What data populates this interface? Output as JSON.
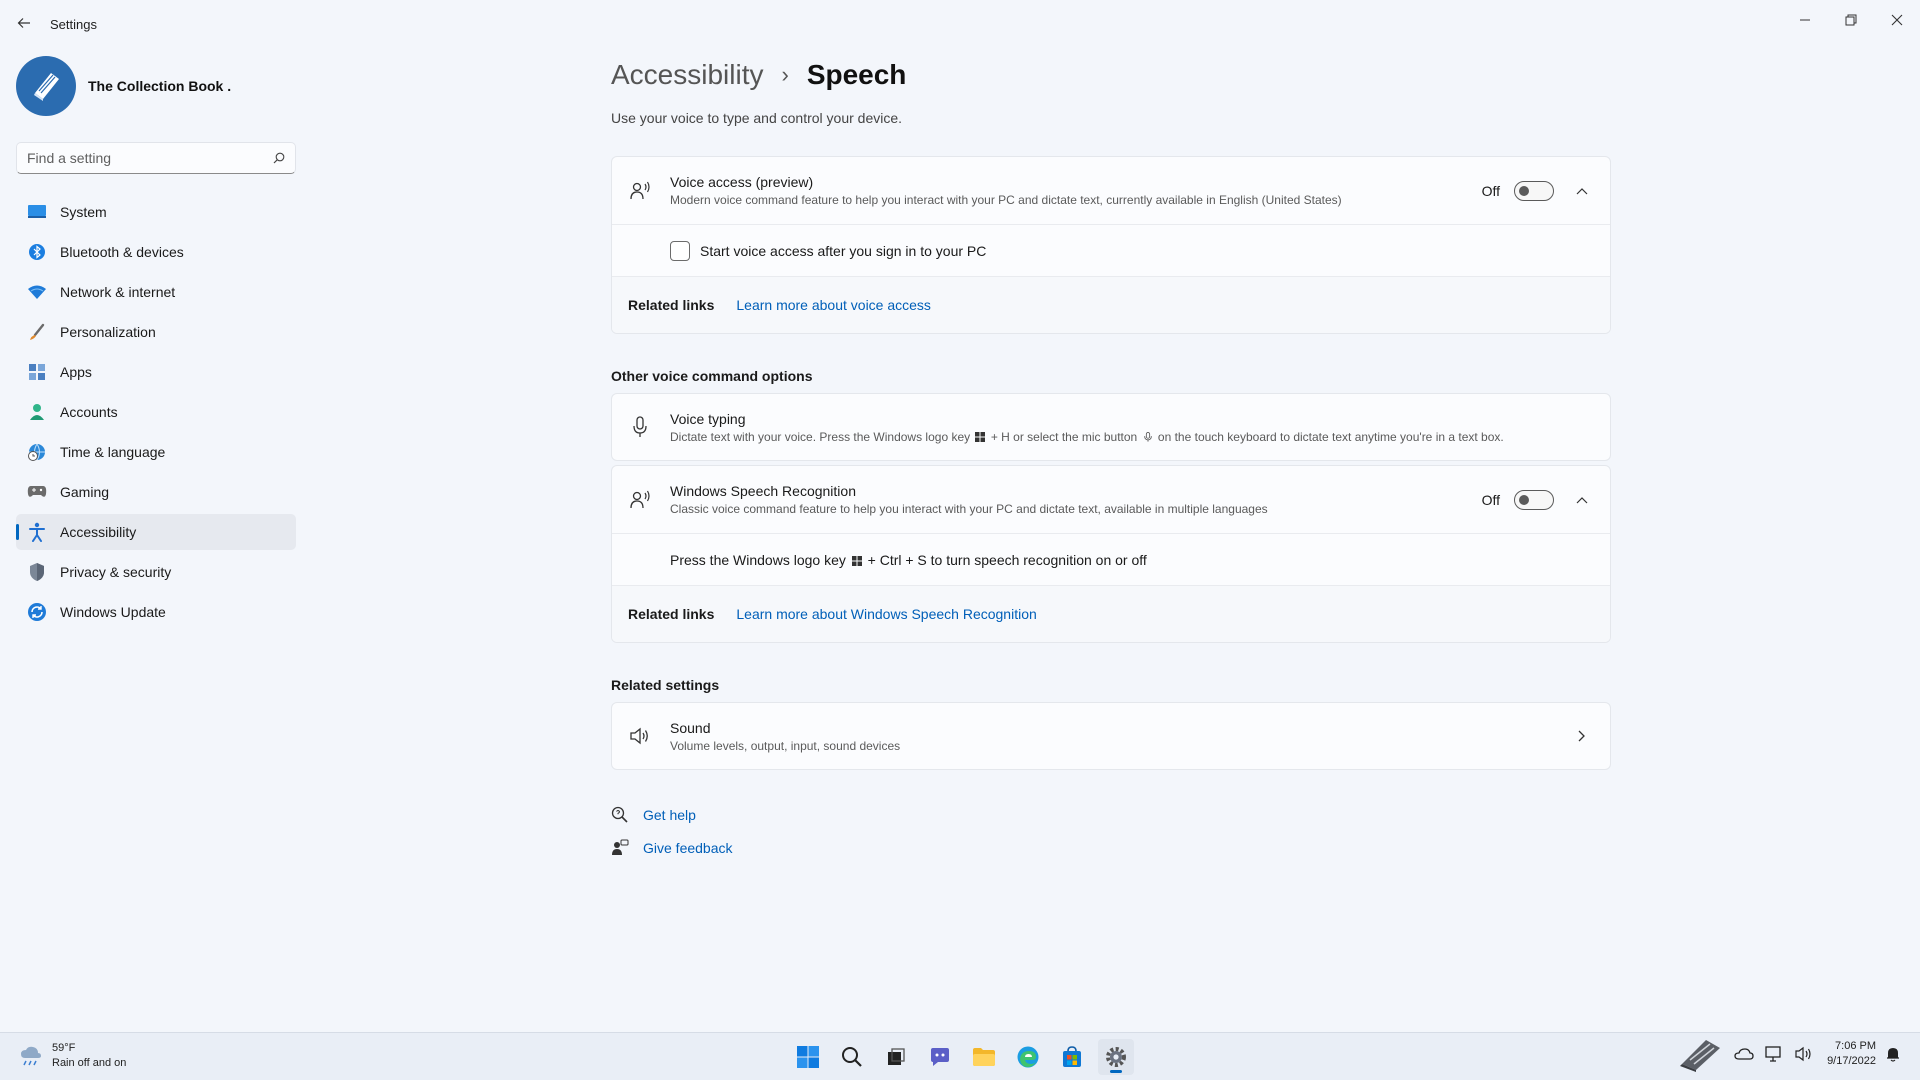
{
  "window": {
    "title": "Settings"
  },
  "profile": {
    "name": "The Collection Book ."
  },
  "search": {
    "placeholder": "Find a setting"
  },
  "nav": [
    {
      "id": "system",
      "label": "System",
      "icon": "monitor-icon",
      "color": "#0078d4"
    },
    {
      "id": "bluetooth",
      "label": "Bluetooth & devices",
      "icon": "bluetooth-icon",
      "color": "#0078d4"
    },
    {
      "id": "network",
      "label": "Network & internet",
      "icon": "wifi-icon",
      "color": "#1f7bd8"
    },
    {
      "id": "personalization",
      "label": "Personalization",
      "icon": "brush-icon",
      "color": "#d97b2b"
    },
    {
      "id": "apps",
      "label": "Apps",
      "icon": "apps-icon",
      "color": "#4a7fc0"
    },
    {
      "id": "accounts",
      "label": "Accounts",
      "icon": "person-icon",
      "color": "#2fb58a"
    },
    {
      "id": "time",
      "label": "Time & language",
      "icon": "globe-clock-icon",
      "color": "#2b88d8"
    },
    {
      "id": "gaming",
      "label": "Gaming",
      "icon": "gamepad-icon",
      "color": "#6b6b6b"
    },
    {
      "id": "accessibility",
      "label": "Accessibility",
      "icon": "accessibility-icon",
      "color": "#1f6fd1",
      "active": true
    },
    {
      "id": "privacy",
      "label": "Privacy & security",
      "icon": "shield-icon",
      "color": "#6b7a8c"
    },
    {
      "id": "update",
      "label": "Windows Update",
      "icon": "update-icon",
      "color": "#1f7bd8"
    }
  ],
  "breadcrumb": {
    "parent": "Accessibility",
    "separator": "›",
    "current": "Speech"
  },
  "page": {
    "description": "Use your voice to type and control your device."
  },
  "voice_access": {
    "title": "Voice access (preview)",
    "description": "Modern voice command feature to help you interact with your PC and dictate text, currently available in English (United States)",
    "toggle_label": "Off",
    "toggle_on": false,
    "checkbox_label": "Start voice access after you sign in to your PC",
    "checkbox_checked": false,
    "related_label": "Related links",
    "related_link": "Learn more about voice access"
  },
  "other_options": {
    "title": "Other voice command options"
  },
  "voice_typing": {
    "title": "Voice typing",
    "description_part1": "Dictate text with your voice. Press the Windows logo key",
    "description_part2": "+ H or select the mic button",
    "description_part3": "on the touch keyboard to dictate text anytime you're in a text box."
  },
  "speech_recognition": {
    "title": "Windows Speech Recognition",
    "description": "Classic voice command feature to help you interact with your PC and dictate text, available in multiple languages",
    "toggle_label": "Off",
    "toggle_on": false,
    "shortcut_part1": "Press the Windows logo key",
    "shortcut_part2": "+ Ctrl + S to turn speech recognition on or off",
    "related_label": "Related links",
    "related_link": "Learn more about Windows Speech Recognition"
  },
  "related_settings": {
    "title": "Related settings",
    "sound_title": "Sound",
    "sound_description": "Volume levels, output, input, sound devices"
  },
  "help": {
    "get_help": "Get help",
    "give_feedback": "Give feedback"
  },
  "taskbar": {
    "weather_temp": "59°F",
    "weather_desc": "Rain off and on",
    "time": "7:06 PM",
    "date": "9/17/2022"
  },
  "colors": {
    "accent": "#0067c0",
    "link": "#005fb8"
  }
}
